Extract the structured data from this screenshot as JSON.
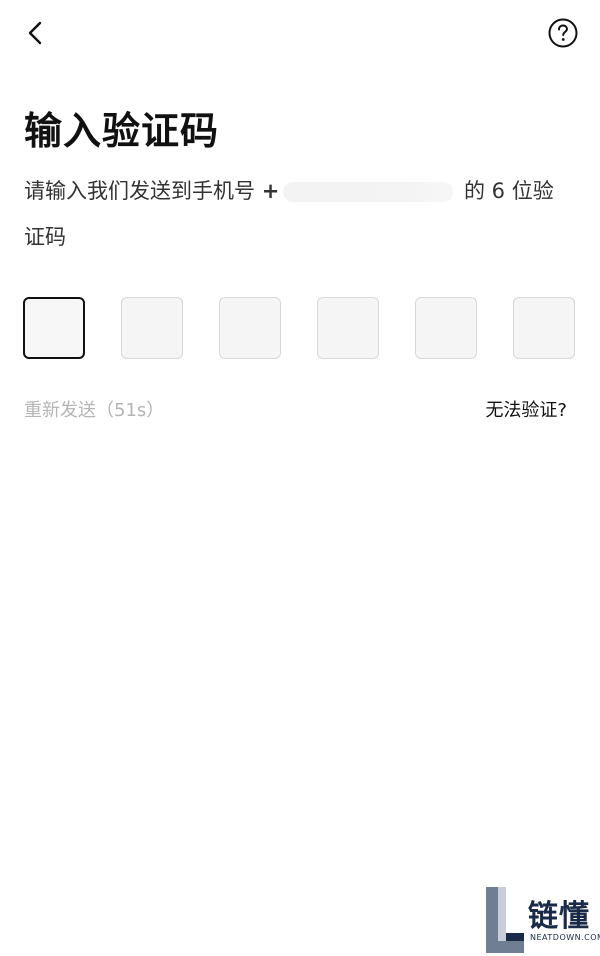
{
  "header": {
    "back_icon": "chevron-left-icon",
    "help_icon": "question-circle-icon"
  },
  "title": "输入验证码",
  "description": {
    "prefix": "请输入我们发送到手机号",
    "phone_visible": "+",
    "suffix": "的 6 位验证码"
  },
  "code_input": {
    "length": 6,
    "active_index": 0
  },
  "resend": {
    "label": "重新发送（51s）"
  },
  "cant_verify": {
    "label": "无法验证?"
  },
  "watermark": {
    "text": "链懂",
    "sub": "NEATDOWN.COM"
  }
}
